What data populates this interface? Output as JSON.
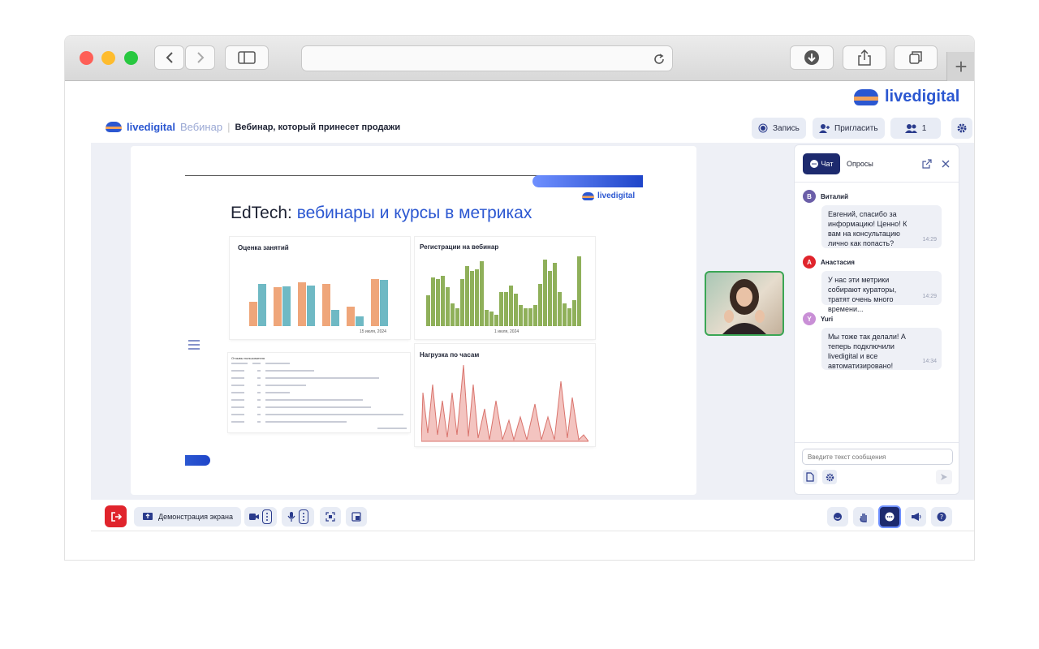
{
  "browser": {
    "back_icon": "chevron-left-icon",
    "forward_icon": "chevron-right-icon",
    "new_tab_glyph": "+"
  },
  "brand": {
    "name": "livedigital"
  },
  "header": {
    "brand": "livedigital",
    "section": "Вебинар",
    "title": "Вебинар, который принесет продажи",
    "record_label": "Запись",
    "invite_label": "Пригласить",
    "participants_count": "1"
  },
  "slide": {
    "title_prefix": "EdTech: ",
    "title_highlight": "вебинары и курсы в метриках",
    "brand": "livedigital",
    "lesson_rating": {
      "title": "Оценка занятий",
      "date": "15 июля, 2024"
    },
    "registrations": {
      "title": "Регистрации на вебинар",
      "date": "1 июля, 2024"
    },
    "hourly_load": {
      "title": "Нагрузка по часам"
    },
    "table": {
      "title": "Отзывы пользователя"
    }
  },
  "chat": {
    "tab_chat": "Чат",
    "tab_polls": "Опросы",
    "input_placeholder": "Введите текст сообщения",
    "messages": [
      {
        "initial": "В",
        "author": "Виталий",
        "text": "Евгений, спасибо за информацию! Ценно! К вам на консультацию лично как попасть?",
        "time": "14:29",
        "color": "#6b5ea8"
      },
      {
        "initial": "А",
        "author": "Анастасия",
        "text": "У нас эти метрики собирают кураторы, тратят очень много времени...",
        "time": "14:29",
        "color": "#e0242c"
      },
      {
        "initial": "Y",
        "author": "Yuri",
        "text": "Мы тоже так делали! А теперь подключили livedigital и все автоматизировано!",
        "time": "14:34",
        "color": "#c98fd6"
      }
    ]
  },
  "toolbar": {
    "screen_share_label": "Демонстрация экрана"
  }
}
